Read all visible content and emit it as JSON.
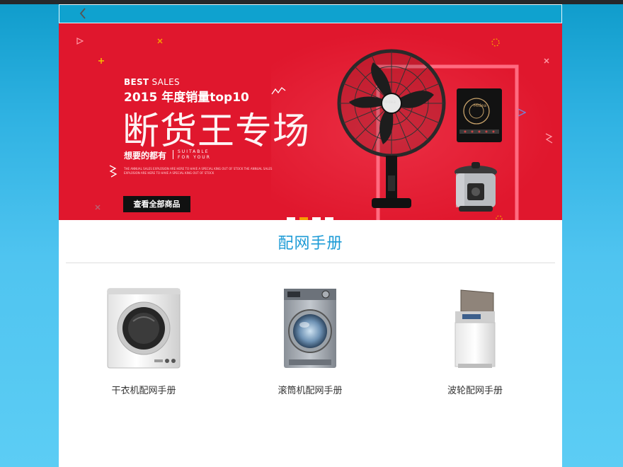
{
  "nav": {
    "back_icon": "chevron-left-icon"
  },
  "banner": {
    "best_bold": "BEST",
    "best_rest": " SALES",
    "year_line": "2015 年度销量top10",
    "headline": "断货王专场",
    "tagline": "想要的都有",
    "suitable_1": "SUITABLE",
    "suitable_2": "FOR YOUR",
    "fine_print": "THE ANNUAL SALES EXPLOSION ARE HERE TO HAVE A SPECIAL KING OUT OF STOCK THE ANNUAL SALES EXPLOSION ARE HERE TO HAVE A SPECIAL KING OUT OF STOCK",
    "cta_label": "查看全部商品",
    "brand": "Midea",
    "active_slide": 2,
    "slide_count": 4,
    "colors": {
      "background": "#e0172d",
      "dot_active": "#f5a000"
    }
  },
  "section": {
    "title": "配网手册"
  },
  "cards": [
    {
      "label": "干衣机配网手册",
      "icon": "dryer-icon"
    },
    {
      "label": "滚筒机配网手册",
      "icon": "front-load-washer-icon"
    },
    {
      "label": "波轮配网手册",
      "icon": "top-load-washer-icon"
    }
  ],
  "colors": {
    "navbar": "#0fa2cf",
    "accent": "#1d9bd6"
  }
}
